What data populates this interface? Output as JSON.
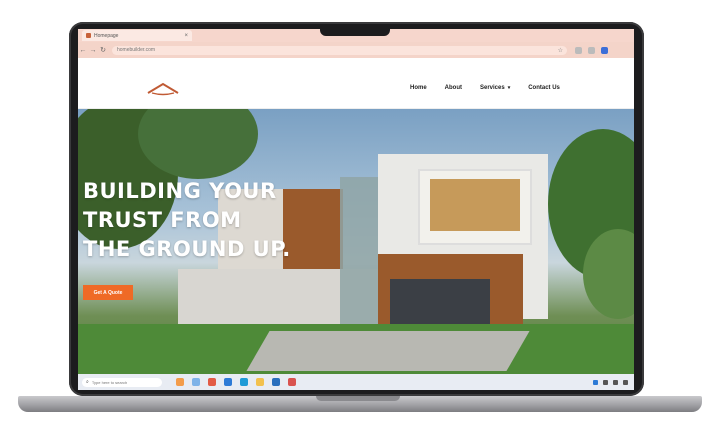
{
  "browser": {
    "tab_title": "Homepage",
    "url": "homebuilder.com"
  },
  "nav": {
    "items": [
      {
        "label": "Home"
      },
      {
        "label": "About"
      },
      {
        "label": "Services"
      },
      {
        "label": "Contact Us"
      }
    ]
  },
  "hero": {
    "headline_lines": [
      "BUILDING YOUR",
      "TRUST FROM",
      "THE GROUND UP."
    ],
    "cta_label": "Get A Quote"
  },
  "taskbar": {
    "search_placeholder": "Type here to search"
  },
  "colors": {
    "accent": "#ef6a26",
    "chrome": "#f6d6cc",
    "hero_text": "#ffffff"
  },
  "icons": [
    "back-icon",
    "forward-icon",
    "reload-icon",
    "star-icon",
    "search-icon",
    "house-logo-icon",
    "chevron-down-icon"
  ]
}
